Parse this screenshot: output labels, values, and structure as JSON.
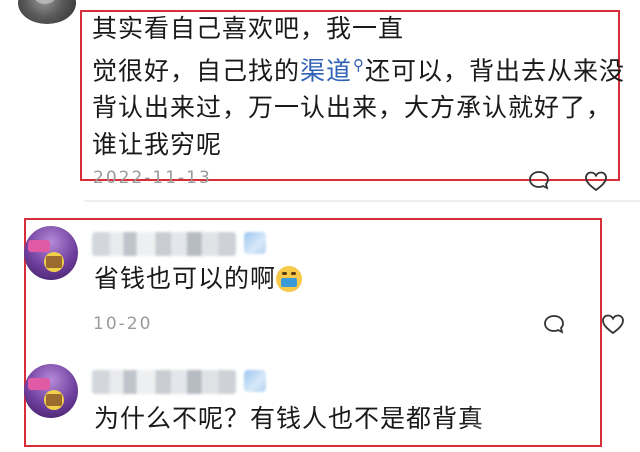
{
  "comments": [
    {
      "text_before_link": "其实看自己喜欢吧，我一直觉很好，自己找的",
      "line1": "其实看自己喜欢吧，我一直",
      "line2_pre": "觉很好，自己找的",
      "link": "渠道",
      "line2_post": "还可以，背出去从来没",
      "line3": "背认出来过，万一认出来，大方承认就好了，",
      "line4": "谁让我穷呢",
      "date": "2022-11-13",
      "icons": [
        "avatar",
        "search-icon",
        "reply-icon",
        "like-icon"
      ]
    },
    {
      "text": "省钱也可以的啊",
      "emoji": "grinning-face-emoji",
      "date": "10-20",
      "icons": [
        "reply-icon",
        "like-icon"
      ]
    },
    {
      "text": "为什么不呢？有钱人也不是都背真"
    }
  ],
  "colors": {
    "highlight_box": "#d62f3a",
    "link": "#2f62b6",
    "date": "#9a9a9a"
  }
}
